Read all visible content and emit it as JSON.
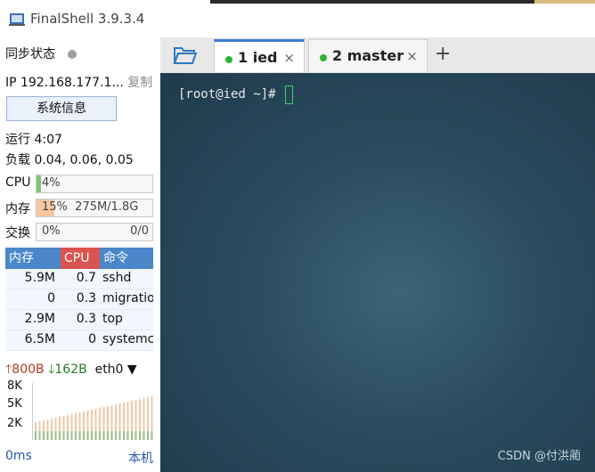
{
  "window": {
    "title": "FinalShell 3.9.3.4"
  },
  "sidebar": {
    "sync_label": "同步状态",
    "ip_label": "IP 192.168.177.1...",
    "copy_label": "复制",
    "sysinfo_button": "系统信息",
    "uptime": "运行 4:07",
    "load": "负载 0.04, 0.06, 0.05",
    "cpu": {
      "label": "CPU",
      "value": "4%",
      "percent": 4
    },
    "mem": {
      "label": "内存",
      "value": "15%",
      "detail": "275M/1.8G",
      "percent": 15
    },
    "swap": {
      "label": "交换",
      "value": "0%",
      "detail": "0/0",
      "percent": 0
    },
    "process_table": {
      "headers": [
        "内存",
        "CPU",
        "命令"
      ],
      "rows": [
        {
          "mem": "5.9M",
          "cpu": "0.7",
          "cmd": "sshd"
        },
        {
          "mem": "0",
          "cpu": "0.3",
          "cmd": "migratio"
        },
        {
          "mem": "2.9M",
          "cpu": "0.3",
          "cmd": "top"
        },
        {
          "mem": "6.5M",
          "cpu": "0",
          "cmd": "systemc"
        }
      ]
    },
    "network": {
      "upload": "800B",
      "download": "162B",
      "interface": "eth0",
      "y_ticks": [
        "8K",
        "5K",
        "2K"
      ]
    },
    "latency": "0ms",
    "host": "本机"
  },
  "tabs": [
    {
      "label": "1 ied",
      "active": true
    },
    {
      "label": "2 master",
      "active": false
    }
  ],
  "tab_close_symbol": "×",
  "add_tab_symbol": "+",
  "terminal": {
    "prompt": "[root@ied ~]#"
  },
  "watermark": "CSDN @付洪蔺",
  "colors": {
    "accent": "#3a7bd5",
    "status_green": "#2db52d",
    "table_header_blue": "#4a86c8",
    "table_header_red": "#d9534f",
    "terminal_bg": "#2a4b5e"
  }
}
